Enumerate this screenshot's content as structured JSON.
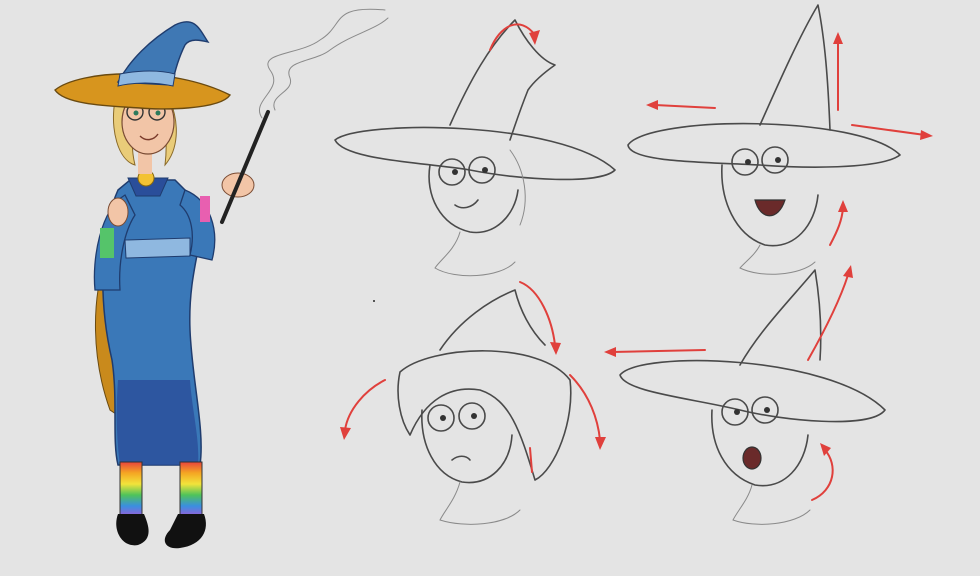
{
  "scene": {
    "background_color": "#e4e4e4",
    "subject": "witch-character-model-sheet",
    "colors": {
      "hat_blue": "#3f78b4",
      "hat_band": "#8fb8e0",
      "brim_gold": "#d7951e",
      "robe_blue": "#3a78b8",
      "robe_dark": "#2a4e9a",
      "hair_blonde": "#e9cc79",
      "skin": "#f2c5a7",
      "sketch_line": "#4a4a4a",
      "arrow_red": "#e0403c"
    },
    "sketches": [
      {
        "expression": "smirk",
        "arrows": 1
      },
      {
        "expression": "excited",
        "arrows": 4
      },
      {
        "expression": "grumpy",
        "arrows": 3
      },
      {
        "expression": "shocked",
        "arrows": 3
      }
    ]
  }
}
